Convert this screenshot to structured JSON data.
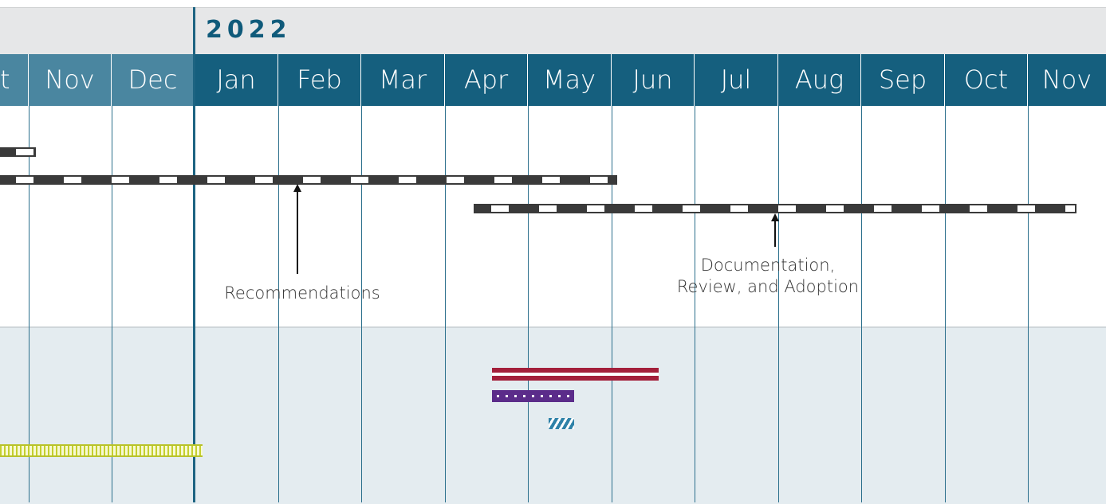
{
  "header": {
    "year": "2022"
  },
  "months": [
    {
      "label": "t"
    },
    {
      "label": "Nov"
    },
    {
      "label": "Dec"
    },
    {
      "label": "Jan"
    },
    {
      "label": "Feb"
    },
    {
      "label": "Mar"
    },
    {
      "label": "Apr"
    },
    {
      "label": "May"
    },
    {
      "label": "Jun"
    },
    {
      "label": "Jul"
    },
    {
      "label": "Aug"
    },
    {
      "label": "Sep"
    },
    {
      "label": "Oct"
    },
    {
      "label": "Nov"
    }
  ],
  "milestones": {
    "recommendations": "Recommendations",
    "documentation_line1": "Documentation,",
    "documentation_line2": "Review, and Adoption"
  },
  "colors": {
    "header_band": "#e6e7e8",
    "month_row": "#155f7e",
    "prev_year_months": "#4a86a0",
    "lower_band": "#e4ecf0",
    "red_bar": "#a31f3a",
    "purple_bar": "#5b2c8a",
    "hatch_bar": "#2f82a8",
    "green_bar": "#c4cf2e"
  }
}
